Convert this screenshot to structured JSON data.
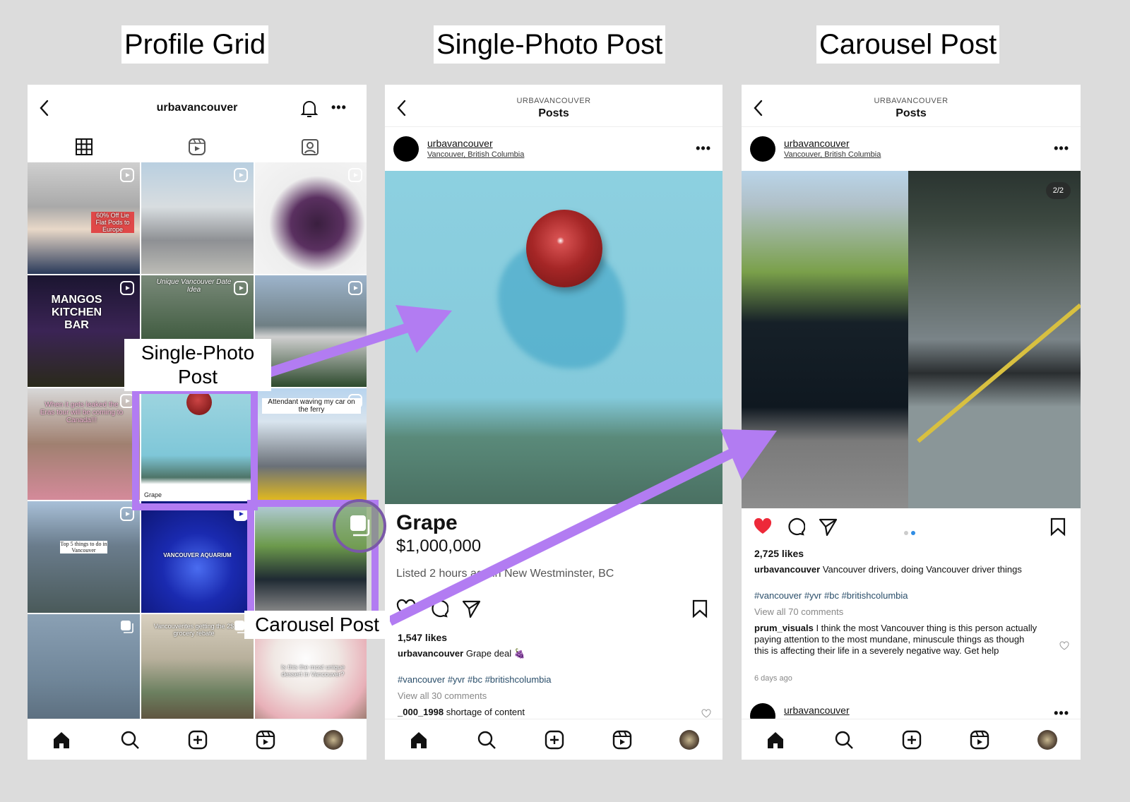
{
  "section_titles": [
    "Profile Grid",
    "Single-Photo Post",
    "Carousel Post"
  ],
  "annotations": {
    "single_photo_label": "Single-Photo Post",
    "carousel_label": "Carousel Post",
    "accent_color": "#b27cf2"
  },
  "profile": {
    "username": "urbavancouver",
    "tabs": [
      "grid",
      "reels",
      "tagged"
    ],
    "tiles": [
      {
        "type": "reel",
        "caption": "60% Off Lie Flat Pods to Europe"
      },
      {
        "type": "reel",
        "caption": ""
      },
      {
        "type": "reel",
        "caption": ""
      },
      {
        "type": "reel",
        "caption": "MANGOS KITCHEN BAR"
      },
      {
        "type": "reel",
        "caption": "Unique Vancouver Date Idea"
      },
      {
        "type": "reel",
        "caption": ""
      },
      {
        "type": "reel",
        "caption": "When it gets leaked the Eras tour will be coming to Canada!!!"
      },
      {
        "type": "photo",
        "caption": "Grape"
      },
      {
        "type": "reel",
        "caption": "Attendant waving my car on the ferry"
      },
      {
        "type": "reel",
        "caption": "Top 5 things to do in Vancouver"
      },
      {
        "type": "reel",
        "caption": "VANCOUVER AQUARIUM"
      },
      {
        "type": "carousel",
        "caption": ""
      },
      {
        "type": "carousel",
        "caption": ""
      },
      {
        "type": "carousel",
        "caption": "Vancouverites getting the 2$ grocery rebate"
      },
      {
        "type": "reel",
        "caption": "Is this the most unique dessert in Vancouver?"
      }
    ]
  },
  "single_post": {
    "kicker": "URBAVANCOUVER",
    "title": "Posts",
    "user": "urbavancouver",
    "location": "Vancouver, British Columbia",
    "listing_name": "Grape",
    "listing_price": "$1,000,000",
    "listing_meta": "Listed 2 hours ago in New Westminster, BC",
    "likes": "1,547 likes",
    "caption_user": "urbavancouver",
    "caption_text": "Grape deal 🍇",
    "hashtags": "#vancouver #yvr #bc #britishcolumbia",
    "view_comments": "View all 30 comments",
    "comment_user": "_000_1998",
    "comment_text": "shortage of content"
  },
  "carousel_post": {
    "kicker": "URBAVANCOUVER",
    "title": "Posts",
    "user": "urbavancouver",
    "location": "Vancouver, British Columbia",
    "slide_counter": "2/2",
    "current_slide": 2,
    "total_slides": 2,
    "liked": true,
    "likes": "2,725 likes",
    "caption_user": "urbavancouver",
    "caption_text": "Vancouver drivers, doing Vancouver driver things",
    "hashtags": "#vancouver #yvr #bc #britishcolumbia",
    "view_comments": "View all 70 comments",
    "comment_user": "prum_visuals",
    "comment_text": "I think the most Vancouver thing is this person actually paying attention to the most mundane, minuscule things as though this is affecting their life in a severely negative way. Get help",
    "comment_time": "6 days ago",
    "next_user": "urbavancouver"
  },
  "colors": {
    "like_red": "#ed2939",
    "dot_active": "#2f8de4",
    "hashtag": "#2a4e6a"
  }
}
